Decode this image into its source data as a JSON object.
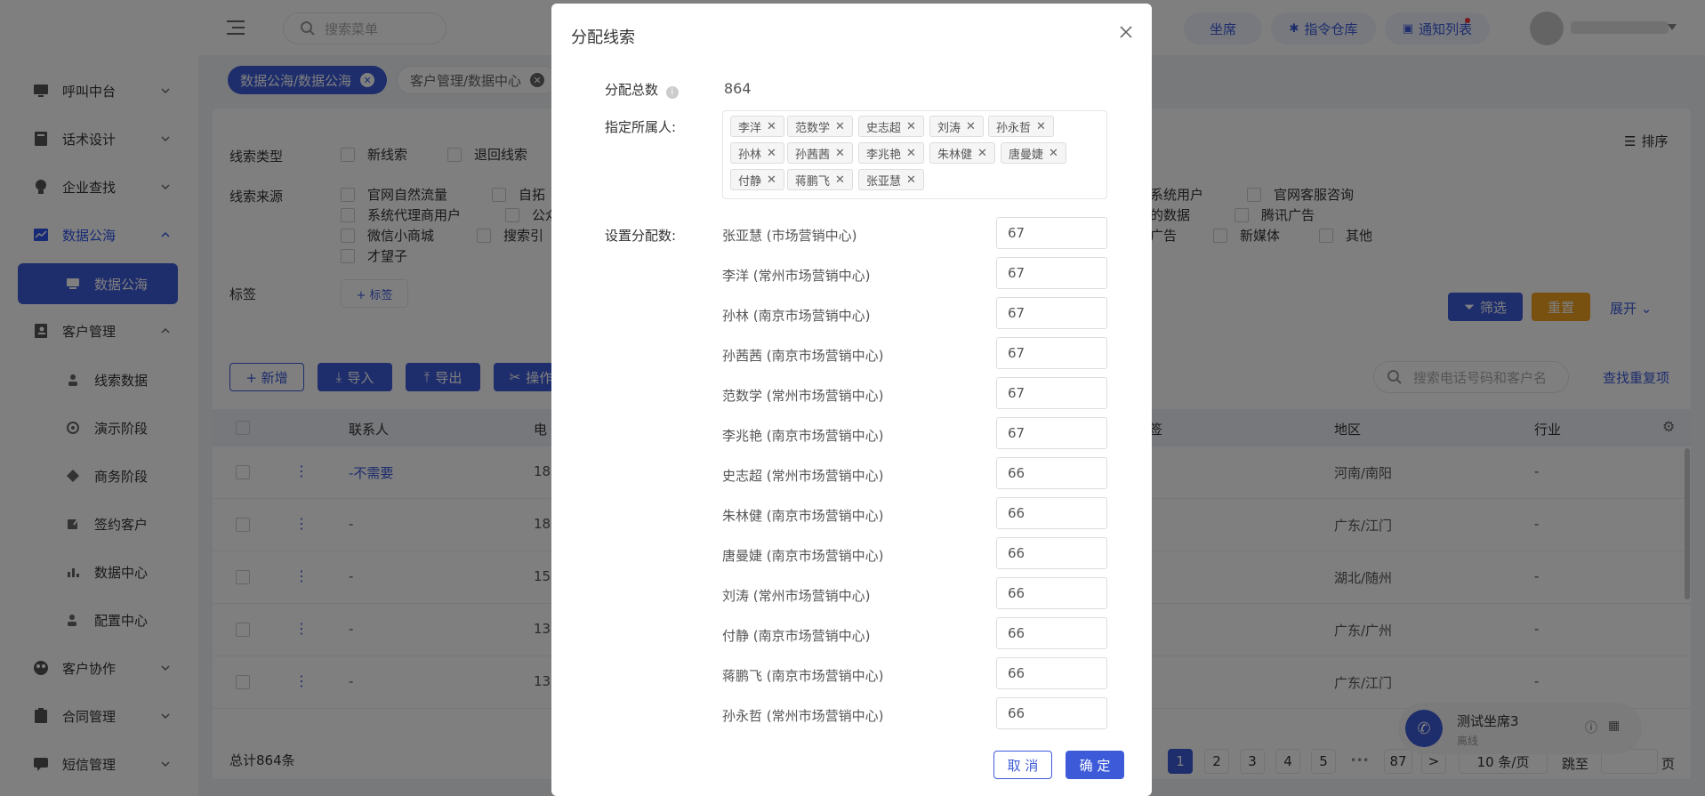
{
  "sidebar": {
    "items": [
      {
        "label": "呼叫中台",
        "icon": "monitor-icon"
      },
      {
        "label": "话术设计",
        "icon": "book-icon"
      },
      {
        "label": "企业查找",
        "icon": "bulb-icon"
      },
      {
        "label": "数据公海",
        "icon": "chart-icon"
      },
      {
        "label": "客户管理",
        "icon": "contacts-icon"
      },
      {
        "label": "客户协作",
        "icon": "team-icon"
      },
      {
        "label": "合同管理",
        "icon": "clipboard-icon"
      },
      {
        "label": "短信管理",
        "icon": "message-icon"
      }
    ],
    "sub_data_sea": [
      {
        "label": "数据公海"
      }
    ],
    "sub_customer": [
      {
        "label": "线索数据"
      },
      {
        "label": "演示阶段"
      },
      {
        "label": "商务阶段"
      },
      {
        "label": "签约客户"
      },
      {
        "label": "数据中心"
      },
      {
        "label": "配置中心"
      }
    ]
  },
  "topbar": {
    "search_placeholder": "搜索菜单",
    "seat_label": "坐席",
    "command_label": "指令仓库",
    "notify_label": "通知列表"
  },
  "tabs": [
    {
      "label": "数据公海/数据公海"
    },
    {
      "label": "客户管理/数据中心"
    }
  ],
  "filters": {
    "lead_type_label": "线索类型",
    "lead_types": [
      "新线索",
      "退回线索"
    ],
    "source_label": "线索来源",
    "sources_left_row1": [
      "官网自然流量",
      "自拓"
    ],
    "sources_left_row2": [
      "系统代理商用户",
      "公众"
    ],
    "sources_left_row3": [
      "微信小商城",
      "搜索引"
    ],
    "sources_left_row4": [
      "才望子"
    ],
    "sources_right_row1": [
      "系统用户",
      "官网客服咨询"
    ],
    "sources_right_row2": [
      "的数据",
      "腾讯广告"
    ],
    "sources_right_row3": [
      "广告",
      "新媒体",
      "其他"
    ],
    "tag_label": "标签",
    "tag_add": "+ 标签",
    "sort_label": "排序",
    "filter_btn": "筛选",
    "reset_btn": "重置",
    "expand_btn": "展开"
  },
  "toolbar": {
    "add": "+ 新增",
    "import": "导入",
    "export": "导出",
    "ops": "操作",
    "search_placeholder": "搜索电话号码和客户名",
    "find_dup": "查找重复项"
  },
  "table": {
    "headers": {
      "contact": "联系人",
      "phone": "电",
      "tags": "签",
      "region": "地区",
      "industry": "行业"
    },
    "rows": [
      {
        "contact": "-不需要",
        "phone": "18",
        "region": "河南/南阳",
        "industry": "-"
      },
      {
        "contact": "-",
        "phone": "18",
        "region": "广东/江门",
        "industry": "-"
      },
      {
        "contact": "-",
        "phone": "15",
        "region": "湖北/随州",
        "industry": "-"
      },
      {
        "contact": "-",
        "phone": "13",
        "region": "广东/广州",
        "industry": "-"
      },
      {
        "contact": "-",
        "phone": "13",
        "region": "广东/江门",
        "industry": "-"
      }
    ],
    "total": "总计864条"
  },
  "pagination": {
    "pages": [
      "1",
      "2",
      "3",
      "4",
      "5"
    ],
    "ellipsis": "•••",
    "last": "87",
    "next": ">",
    "page_size": "10 条/页",
    "goto_label": "跳至",
    "page_unit": "页"
  },
  "call_widget": {
    "name": "测试坐席3",
    "status": "离线"
  },
  "modal": {
    "title": "分配线索",
    "total_label": "分配总数",
    "total_value": "864",
    "owner_label": "指定所属人:",
    "owners": [
      "李洋",
      "范数学",
      "史志超",
      "刘涛",
      "孙永哲",
      "孙林",
      "孙茜茜",
      "李兆艳",
      "朱林健",
      "唐曼婕",
      "付静",
      "蒋鹏飞",
      "张亚慧"
    ],
    "alloc_label": "设置分配数:",
    "allocations": [
      {
        "name": "张亚慧 (市场营销中心)",
        "value": "67"
      },
      {
        "name": "李洋 (常州市场营销中心)",
        "value": "67"
      },
      {
        "name": "孙林 (南京市场营销中心)",
        "value": "67"
      },
      {
        "name": "孙茜茜 (南京市场营销中心)",
        "value": "67"
      },
      {
        "name": "范数学 (常州市场营销中心)",
        "value": "67"
      },
      {
        "name": "李兆艳 (南京市场营销中心)",
        "value": "67"
      },
      {
        "name": "史志超 (常州市场营销中心)",
        "value": "66"
      },
      {
        "name": "朱林健 (南京市场营销中心)",
        "value": "66"
      },
      {
        "name": "唐曼婕 (南京市场营销中心)",
        "value": "66"
      },
      {
        "name": "刘涛 (常州市场营销中心)",
        "value": "66"
      },
      {
        "name": "付静 (南京市场营销中心)",
        "value": "66"
      },
      {
        "name": "蒋鹏飞 (南京市场营销中心)",
        "value": "66"
      },
      {
        "name": "孙永哲 (常州市场营销中心)",
        "value": "66"
      }
    ],
    "cancel": "取 消",
    "confirm": "确 定"
  },
  "colors": {
    "primary": "#3d5bd9",
    "warning": "#f0a020"
  }
}
